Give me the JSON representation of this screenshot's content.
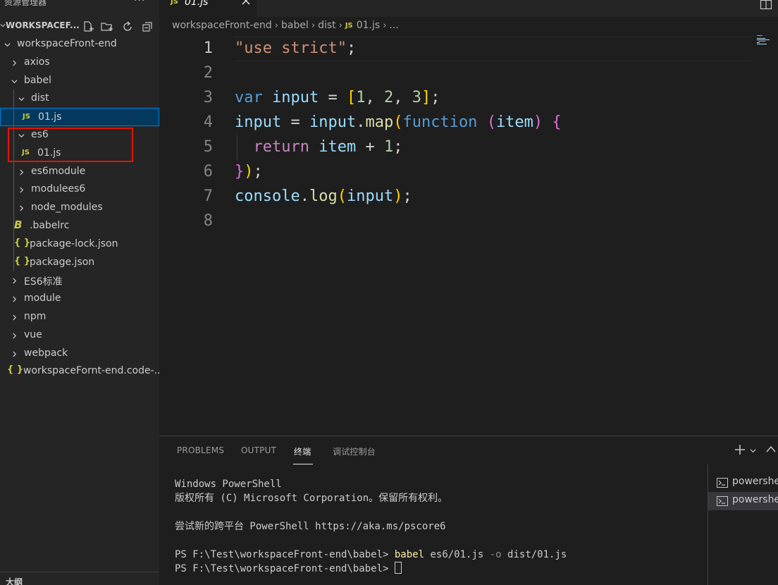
{
  "sidebar": {
    "title": "资源管理器",
    "more": "···",
    "workspace_name": "WORKSPACEF...",
    "tree": [
      {
        "label": "workspaceFront-end",
        "kind": "folder-open",
        "depth": 0
      },
      {
        "label": "axios",
        "kind": "folder",
        "depth": 1
      },
      {
        "label": "babel",
        "kind": "folder-open",
        "depth": 1
      },
      {
        "label": "dist",
        "kind": "folder-open",
        "depth": 2
      },
      {
        "label": "01.js",
        "kind": "js",
        "depth": 3,
        "selected": true
      },
      {
        "label": "es6",
        "kind": "folder-open",
        "depth": 2
      },
      {
        "label": "01.js",
        "kind": "js",
        "depth": 3
      },
      {
        "label": "es6module",
        "kind": "folder",
        "depth": 2
      },
      {
        "label": "modulees6",
        "kind": "folder",
        "depth": 2
      },
      {
        "label": "node_modules",
        "kind": "folder",
        "depth": 2
      },
      {
        "label": ".babelrc",
        "kind": "babel",
        "depth": 2
      },
      {
        "label": "package-lock.json",
        "kind": "json",
        "depth": 2
      },
      {
        "label": "package.json",
        "kind": "json",
        "depth": 2
      },
      {
        "label": "ES6标准",
        "kind": "folder",
        "depth": 1
      },
      {
        "label": "module",
        "kind": "folder",
        "depth": 1
      },
      {
        "label": "npm",
        "kind": "folder",
        "depth": 1
      },
      {
        "label": "vue",
        "kind": "folder",
        "depth": 1
      },
      {
        "label": "webpack",
        "kind": "folder",
        "depth": 1
      },
      {
        "label": "workspaceFornt-end.code-...",
        "kind": "json",
        "depth": 1
      }
    ],
    "icons": {
      "js": "JS",
      "json": "{ }",
      "babel": "B"
    },
    "outline_label": "大纲"
  },
  "editor": {
    "tab_label": "01.js",
    "tab_icon": "JS",
    "breadcrumb": [
      "workspaceFront-end",
      "babel",
      "dist",
      "01.js",
      "..."
    ],
    "line_numbers": [
      "1",
      "2",
      "3",
      "4",
      "5",
      "6",
      "7",
      "8"
    ],
    "code": {
      "l1": "\"use strict\"",
      "l1_semi": ";",
      "var_kw": "var",
      "input": "input",
      "eq": " = ",
      "lbr": "[",
      "n1": "1",
      "n2": "2",
      "n3": "3",
      "comma": ", ",
      "rbr_semi": "];",
      "map": "map",
      "function_kw": "function",
      "item": "item",
      "return_kw": "return",
      "plus": " + ",
      "close_l6": "});",
      "console": "console",
      "log": "log",
      "semi": ";"
    }
  },
  "panel": {
    "tabs": [
      "PROBLEMS",
      "OUTPUT",
      "终端",
      "调试控制台"
    ],
    "active_tab": "终端",
    "terminal_lines": [
      "Windows PowerShell",
      "版权所有 (C) Microsoft Corporation。保留所有权利。",
      "",
      "尝试新的跨平台 PowerShell https://aka.ms/pscore6",
      ""
    ],
    "prompt": "PS F:\\Test\\workspaceFront-end\\babel> ",
    "cmd_name": "babel",
    "cmd_arg1": " es6/01.js ",
    "cmd_flag": "-o",
    "cmd_arg2": " dist/01.js",
    "terminals": [
      "powershell",
      "powershell"
    ]
  },
  "colors": {
    "accent": "#007fd4",
    "highlight_box": "#e51400",
    "js_icon": "#cbcb41"
  }
}
